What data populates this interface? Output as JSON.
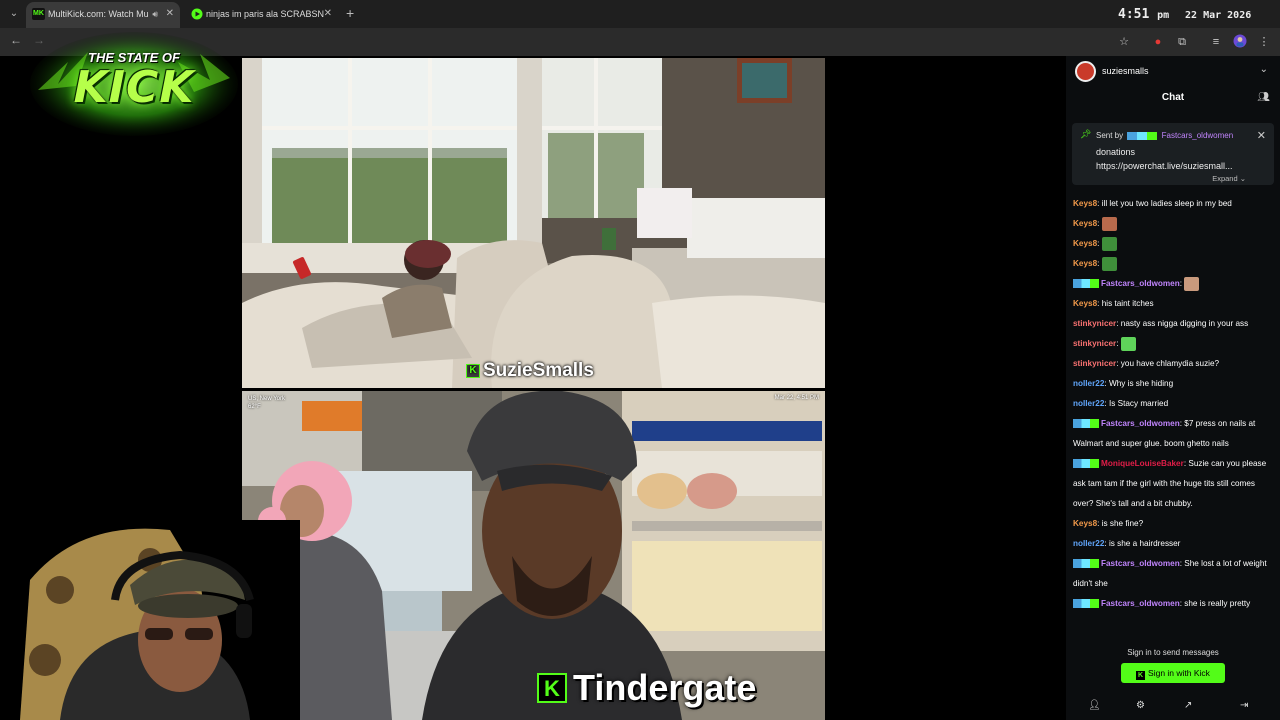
{
  "browser": {
    "tabs": [
      {
        "favicon": "MK",
        "title": "MultiKick.com: Watch Multi",
        "active": true,
        "favicon_color": "#53fc18"
      },
      {
        "favicon": "play-icon",
        "title": "ninjas im paris ala SCRABSNYC",
        "active": false,
        "favicon_color": "#53fc18"
      }
    ],
    "clock": {
      "time": "4:51",
      "ampm": "pm",
      "date": "22 Mar 2026"
    }
  },
  "logo": {
    "line1": "THE STATE OF",
    "line2": "KICK"
  },
  "streams": [
    {
      "name": "SuzieSmalls"
    },
    {
      "name": "Tindergate",
      "location": "US, New York",
      "temperature": "62°F",
      "timestamp": "Mar 22, 4:51 PM"
    }
  ],
  "chat": {
    "channel": "suziesmalls",
    "title": "Chat",
    "pinned": {
      "sent_by_label": "Sent by",
      "sender": "Fastcars_oldwomen",
      "message": "donations",
      "link": "https://powerchat.live/suziesmall...",
      "expand_label": "Expand"
    },
    "messages": [
      {
        "user": "Keys8",
        "color": "#f39a4b",
        "text": "ill let you two ladies sleep in my bed"
      },
      {
        "user": "Keys8",
        "color": "#f39a4b",
        "text": "",
        "emote": "face-emote"
      },
      {
        "user": "Keys8",
        "color": "#f39a4b",
        "text": "",
        "emote": "pepe-emote"
      },
      {
        "user": "Keys8",
        "color": "#f39a4b",
        "text": "",
        "emote": "pepe-emote"
      },
      {
        "user": "Fastcars_oldwomen",
        "color": "#c084fc",
        "badges": true,
        "text": "",
        "emote": "hand-emote"
      },
      {
        "user": "Keys8",
        "color": "#f39a4b",
        "text": "his taint itches"
      },
      {
        "user": "stinkynicer",
        "color": "#f87171",
        "text": "nasty ass nigga digging in your ass"
      },
      {
        "user": "stinkynicer",
        "color": "#f87171",
        "text": "",
        "emote": "green-emote"
      },
      {
        "user": "stinkynicer",
        "color": "#f87171",
        "text": "you have chlamydia suzie?"
      },
      {
        "user": "noller22",
        "color": "#60a5fa",
        "text": "Why is she hiding"
      },
      {
        "user": "noller22",
        "color": "#60a5fa",
        "text": "Is Stacy married"
      },
      {
        "user": "Fastcars_oldwomen",
        "color": "#c084fc",
        "badges": true,
        "text": "$7 press on nails at Walmart and super glue. boom ghetto nails",
        "wrap": true
      },
      {
        "user": "MoniqueLouiseBaker",
        "color": "#e11d48",
        "badges": true,
        "text": "Suzie can you please ask tam tam if the girl with the huge tits still comes over? She's tall and a bit chubby.",
        "wrap": true
      },
      {
        "user": "Keys8",
        "color": "#f39a4b",
        "text": "is she fine?"
      },
      {
        "user": "noller22",
        "color": "#60a5fa",
        "text": "is she a hairdresser"
      },
      {
        "user": "Fastcars_oldwomen",
        "color": "#c084fc",
        "badges": true,
        "text": "She lost a lot of weight didn't she",
        "wrap": true
      },
      {
        "user": "Fastcars_oldwomen",
        "color": "#c084fc",
        "badges": true,
        "text": "she is really pretty",
        "wrap": true
      }
    ],
    "signin_note": "Sign in to send messages",
    "signin_button": "Sign in with Kick"
  }
}
